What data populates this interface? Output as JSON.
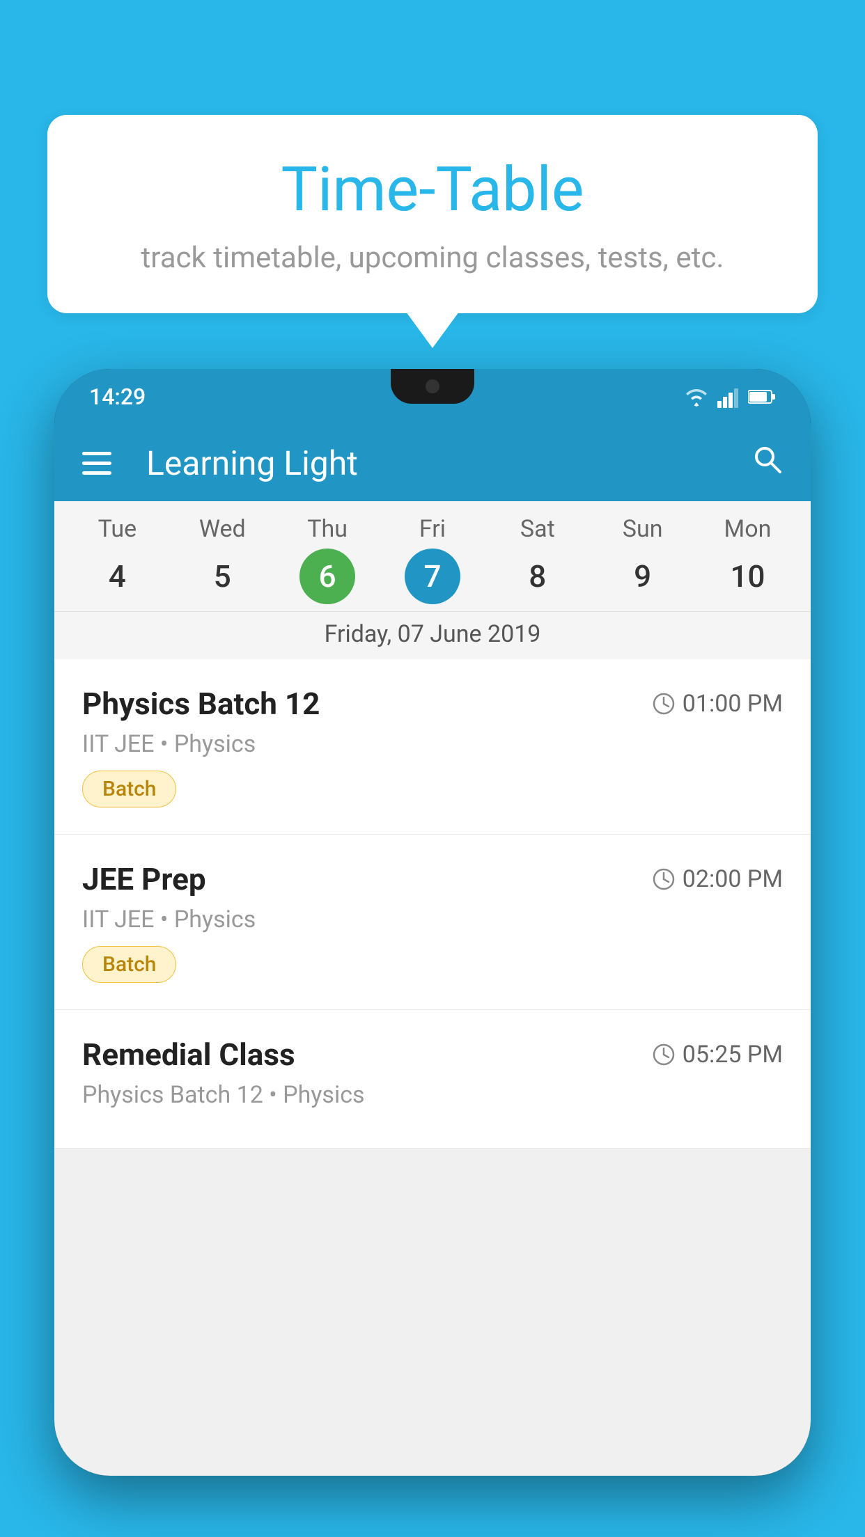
{
  "background_color": "#29b6e8",
  "speech_bubble": {
    "title": "Time-Table",
    "subtitle": "track timetable, upcoming classes, tests, etc."
  },
  "phone": {
    "status_bar": {
      "time": "14:29",
      "icons": [
        "wifi",
        "signal",
        "battery"
      ]
    },
    "app_bar": {
      "title": "Learning Light",
      "search_icon_label": "search"
    },
    "calendar": {
      "days": [
        {
          "label": "Tue",
          "number": "4"
        },
        {
          "label": "Wed",
          "number": "5"
        },
        {
          "label": "Thu",
          "number": "6",
          "state": "today"
        },
        {
          "label": "Fri",
          "number": "7",
          "state": "selected"
        },
        {
          "label": "Sat",
          "number": "8"
        },
        {
          "label": "Sun",
          "number": "9"
        },
        {
          "label": "Mon",
          "number": "10"
        }
      ],
      "selected_date_label": "Friday, 07 June 2019"
    },
    "schedule": [
      {
        "title": "Physics Batch 12",
        "time": "01:00 PM",
        "subtitle": "IIT JEE • Physics",
        "tag": "Batch"
      },
      {
        "title": "JEE Prep",
        "time": "02:00 PM",
        "subtitle": "IIT JEE • Physics",
        "tag": "Batch"
      },
      {
        "title": "Remedial Class",
        "time": "05:25 PM",
        "subtitle": "Physics Batch 12 • Physics",
        "tag": ""
      }
    ]
  }
}
